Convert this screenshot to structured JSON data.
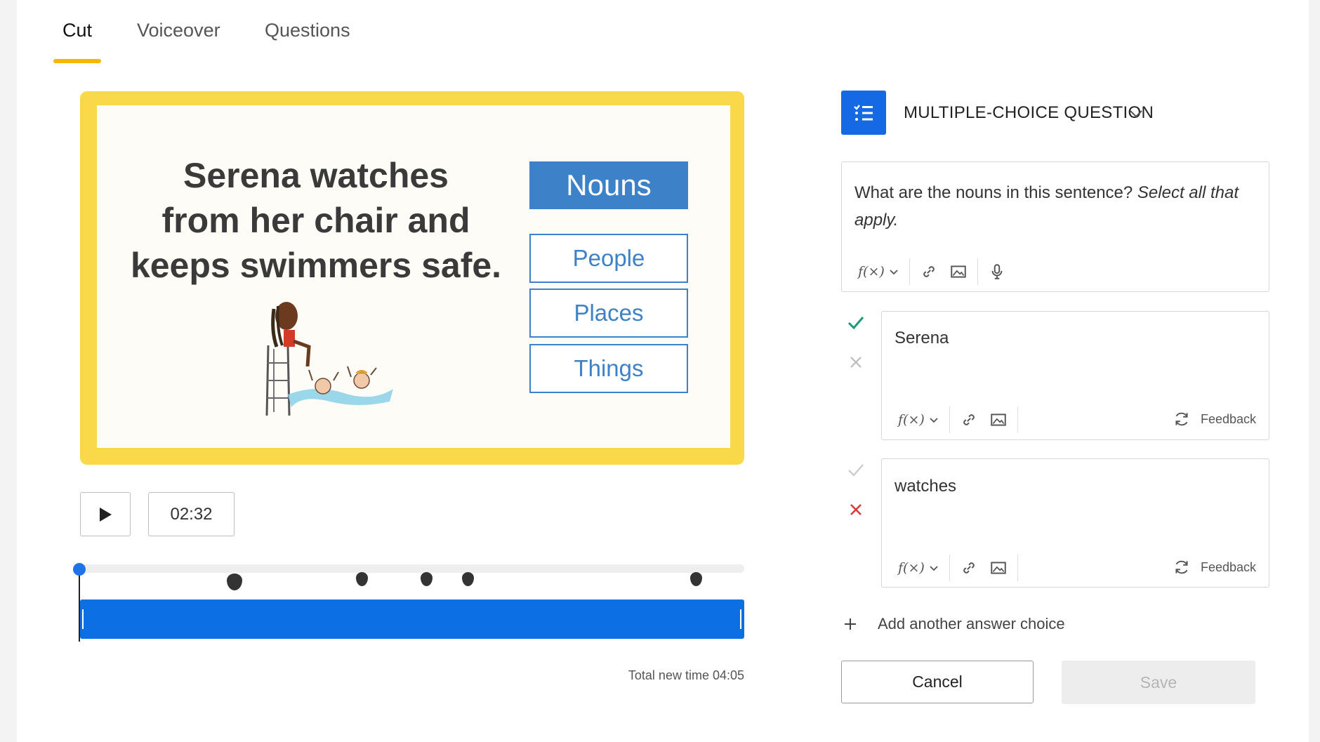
{
  "tabs": [
    {
      "label": "Cut",
      "active": true
    },
    {
      "label": "Voiceover",
      "active": false
    },
    {
      "label": "Questions",
      "active": false
    }
  ],
  "slide": {
    "sentence_line1": "Serena watches",
    "sentence_line2": "from her chair and",
    "sentence_line3": "keeps swimmers safe.",
    "header": "Nouns",
    "options": [
      "People",
      "Places",
      "Things"
    ]
  },
  "player": {
    "current_time": "02:32",
    "total_label": "Total new time 04:05"
  },
  "question": {
    "type_label": "MULTIPLE-CHOICE QUESTION",
    "prompt": "What are the nouns in this sentence?",
    "prompt_hint": "Select all that apply.",
    "formula_label": "f(×)"
  },
  "answers": [
    {
      "text": "Serena",
      "correct": true,
      "feedback_label": "Feedback"
    },
    {
      "text": "watches",
      "correct": false,
      "feedback_label": "Feedback"
    }
  ],
  "actions": {
    "add_choice": "Add another answer choice",
    "cancel": "Cancel",
    "save": "Save"
  },
  "colors": {
    "accent": "#1669e5",
    "tab_underline": "#f5b700",
    "slide_frame": "#f9d949",
    "nouns_blue": "#3d82c8",
    "correct": "#1a9a7a",
    "incorrect": "#d63b3b"
  }
}
